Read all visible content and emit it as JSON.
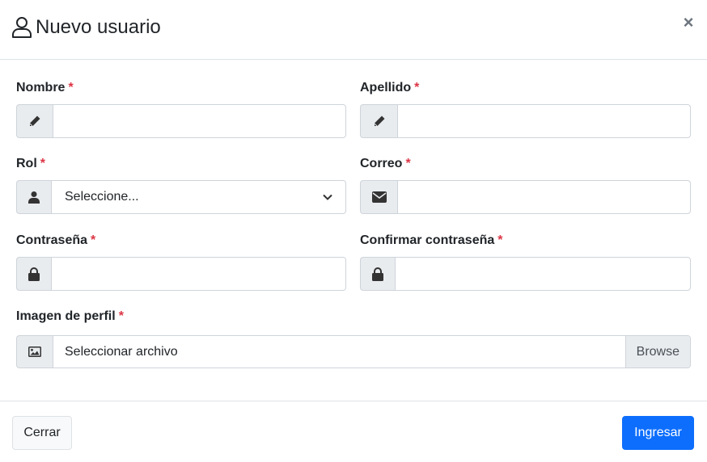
{
  "modal": {
    "title": "Nuevo usuario",
    "title_icon": "user-outline-icon",
    "close_glyph": "×"
  },
  "form": {
    "nombre": {
      "label": "Nombre",
      "required_mark": "*",
      "icon": "pencil-icon",
      "value": ""
    },
    "apellido": {
      "label": "Apellido",
      "required_mark": "*",
      "icon": "pencil-icon",
      "value": ""
    },
    "rol": {
      "label": "Rol",
      "required_mark": "*",
      "icon": "user-icon",
      "selected": "Seleccione..."
    },
    "correo": {
      "label": "Correo",
      "required_mark": "*",
      "icon": "envelope-icon",
      "value": ""
    },
    "contrasena": {
      "label": "Contraseña",
      "required_mark": "*",
      "icon": "lock-icon",
      "value": ""
    },
    "confirmar": {
      "label": "Confirmar contraseña",
      "required_mark": "*",
      "icon": "lock-icon",
      "value": ""
    },
    "imagen": {
      "label": "Imagen de perfil",
      "required_mark": "*",
      "icon": "image-icon",
      "placeholder": "Seleccionar archivo",
      "browse_label": "Browse"
    }
  },
  "footer": {
    "cancel_label": "Cerrar",
    "submit_label": "Ingresar"
  },
  "colors": {
    "primary": "#0d6efd",
    "required": "#dc3545",
    "addon_bg": "#e9ecef",
    "border": "#ced4da"
  }
}
